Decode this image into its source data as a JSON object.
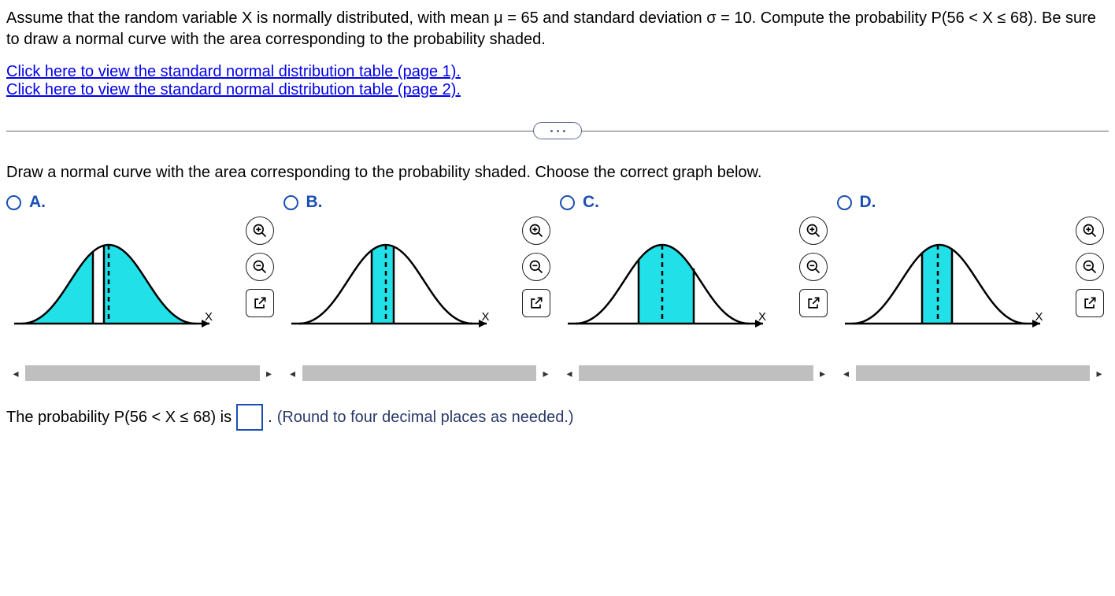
{
  "question": {
    "text": "Assume that the random variable X is normally distributed, with mean μ = 65 and standard deviation σ = 10. Compute the probability P(56 < X ≤ 68). Be sure to draw a normal curve with the area corresponding to the probability shaded."
  },
  "links": {
    "table_page1": "Click here to view the standard normal distribution table (page 1).",
    "table_page2": "Click here to view the standard normal distribution table (page 2)."
  },
  "instruction": "Draw a normal curve with the area corresponding to the probability shaded. Choose the correct graph below.",
  "options": [
    {
      "label": "A.",
      "axis": "X",
      "shade": "outer"
    },
    {
      "label": "B.",
      "axis": "X",
      "shade": "center-narrow"
    },
    {
      "label": "C.",
      "axis": "X",
      "shade": "center-wide"
    },
    {
      "label": "D.",
      "axis": "X",
      "shade": "center-offset"
    }
  ],
  "answer": {
    "prefix": "The probability P(56 < X ≤ 68) is",
    "value": "",
    "suffix": ".",
    "hint": "(Round to four decimal places as needed.)"
  },
  "chart_data": {
    "type": "other",
    "description": "Four multiple-choice thumbnails of a standard normal density curve over an X axis. Each shows a different cyan-shaded region under the curve with dashed center line and two solid vertical bounds near the mean.",
    "distribution": {
      "mean": 65,
      "sd": 10
    },
    "interval": {
      "lower": 56,
      "upper": 68,
      "lower_open": true,
      "upper_closed": true
    },
    "curves": [
      {
        "id": "A",
        "shaded": "two tails (x<56 and x>68) plus small band"
      },
      {
        "id": "B",
        "shaded": "narrow central band around mean"
      },
      {
        "id": "C",
        "shaded": "broad central band roughly 56 to 74"
      },
      {
        "id": "D",
        "shaded": "central band 56 to 68 (correct)"
      }
    ]
  }
}
